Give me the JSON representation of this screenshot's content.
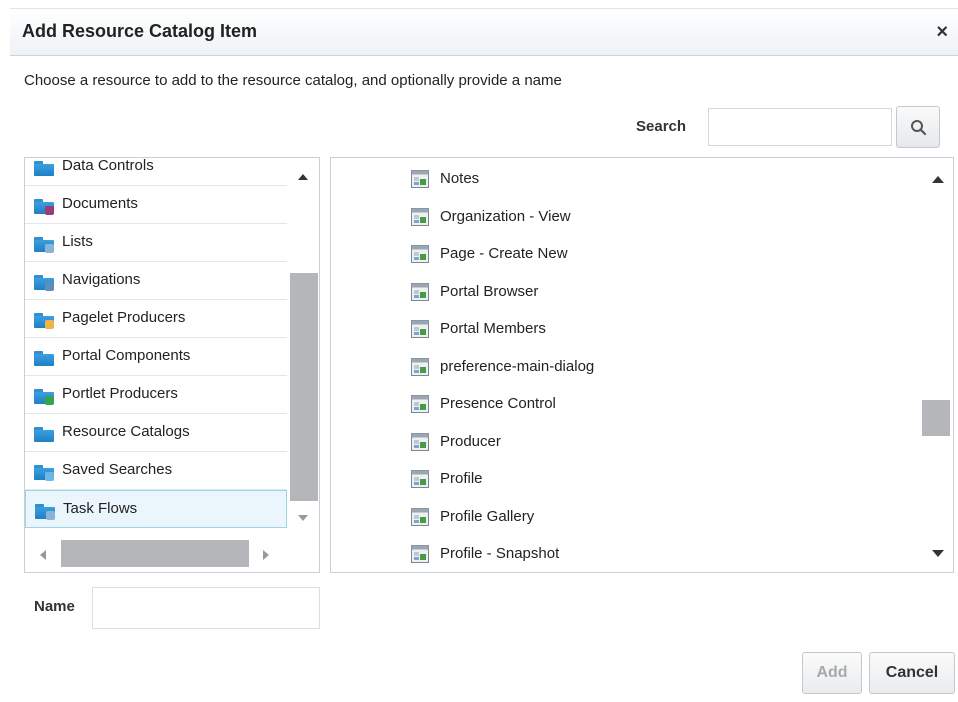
{
  "dialog": {
    "title": "Add Resource Catalog Item",
    "close_glyph": "×",
    "instructions": "Choose a resource to add to the resource catalog, and optionally provide a name"
  },
  "search": {
    "label": "Search",
    "value": "",
    "button_icon": "search-icon"
  },
  "left_list": {
    "items": [
      {
        "label": "Data Controls",
        "icon": "data-controls-folder-icon",
        "badge": ""
      },
      {
        "label": "Documents",
        "icon": "documents-folder-icon",
        "badge": "#9c3b7a"
      },
      {
        "label": "Lists",
        "icon": "lists-folder-icon",
        "badge": "#8ab4d6"
      },
      {
        "label": "Navigations",
        "icon": "navigations-folder-icon",
        "badge": "#5f8fb8"
      },
      {
        "label": "Pagelet Producers",
        "icon": "pagelet-producers-folder-icon",
        "badge": "#f0b34a"
      },
      {
        "label": "Portal Components",
        "icon": "portal-components-folder-icon",
        "badge": ""
      },
      {
        "label": "Portlet Producers",
        "icon": "portlet-producers-folder-icon",
        "badge": "#3aa34a"
      },
      {
        "label": "Resource Catalogs",
        "icon": "resource-catalogs-folder-icon",
        "badge": ""
      },
      {
        "label": "Saved Searches",
        "icon": "saved-searches-folder-icon",
        "badge": "#6fb6e8"
      },
      {
        "label": "Task Flows",
        "icon": "task-flows-folder-icon",
        "badge": "#8ab4d6",
        "selected": true
      }
    ]
  },
  "right_list": {
    "items": [
      {
        "label": "Notes"
      },
      {
        "label": "Organization - View"
      },
      {
        "label": "Page - Create New"
      },
      {
        "label": "Portal Browser"
      },
      {
        "label": "Portal Members"
      },
      {
        "label": "preference-main-dialog"
      },
      {
        "label": "Presence Control"
      },
      {
        "label": "Producer"
      },
      {
        "label": "Profile"
      },
      {
        "label": "Profile Gallery"
      },
      {
        "label": "Profile - Snapshot"
      }
    ],
    "item_icon": "task-flow-icon"
  },
  "name_field": {
    "label": "Name",
    "value": ""
  },
  "buttons": {
    "add_label": "Add",
    "cancel_label": "Cancel"
  },
  "colors": {
    "folder": "#2a8fd6",
    "selected_bg": "#eaf6fb",
    "scroll_thumb": "#b4b6b9"
  }
}
